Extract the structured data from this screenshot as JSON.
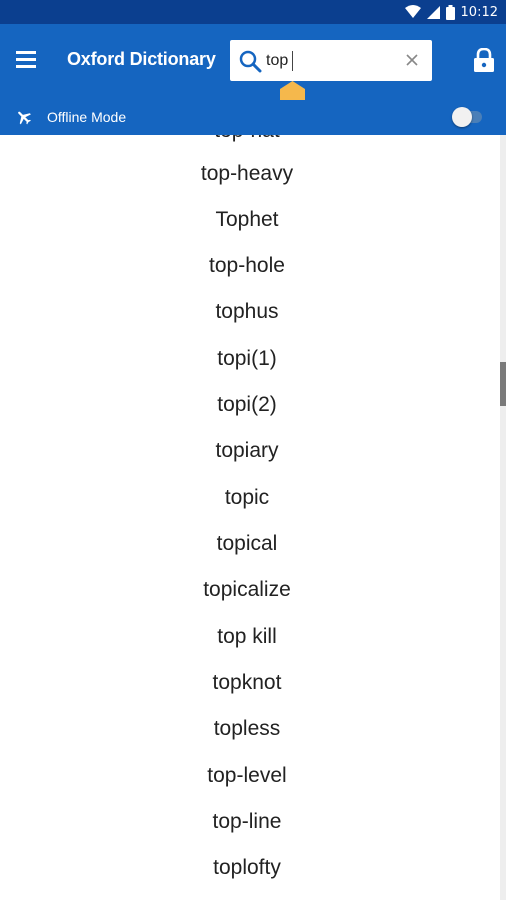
{
  "status_bar": {
    "time": "10:12"
  },
  "app_bar": {
    "title": "Oxford Dictionary",
    "search": {
      "value": "top",
      "placeholder": ""
    }
  },
  "offline": {
    "label": "Offline Mode",
    "enabled": false
  },
  "words": [
    "top-heavy",
    "Tophet",
    "top-hole",
    "tophus",
    "topi(1)",
    "topi(2)",
    "topiary",
    "topic",
    "topical",
    "topicalize",
    "top kill",
    "topknot",
    "topless",
    "top-level",
    "top-line",
    "toplofty"
  ],
  "colors": {
    "app_bar": "#1565c0",
    "status_bar": "#0b3f8f",
    "handle": "#f5b84c"
  }
}
